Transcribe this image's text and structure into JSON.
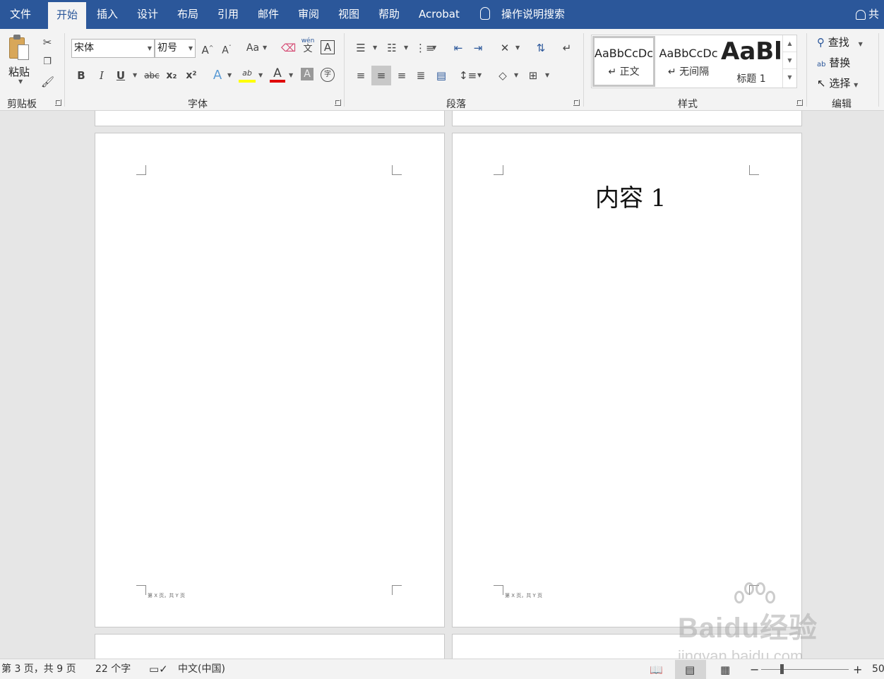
{
  "tabs": {
    "file": "文件",
    "home": "开始",
    "insert": "插入",
    "design": "设计",
    "layout": "布局",
    "references": "引用",
    "mailings": "邮件",
    "review": "审阅",
    "view": "视图",
    "help": "帮助",
    "acrobat": "Acrobat"
  },
  "tell_me": "操作说明搜索",
  "share": "共",
  "clipboard": {
    "paste": "粘贴",
    "group": "剪贴板"
  },
  "font": {
    "name": "宋体",
    "size": "初号",
    "group": "字体",
    "change_case": "Aa",
    "phonetic_top": "wén",
    "phonetic_bottom": "文",
    "bold": "B",
    "italic": "I",
    "underline": "U",
    "strike": "abc",
    "sub": "x₂",
    "sup": "x²",
    "font_color": "A",
    "highlight": "ab",
    "char_shading": "A",
    "enclose": "字"
  },
  "paragraph": {
    "group": "段落"
  },
  "styles": {
    "group": "样式",
    "items": [
      {
        "sample": "AaBbCcDc",
        "name": "↵ 正文"
      },
      {
        "sample": "AaBbCcDc",
        "name": "↵ 无间隔"
      },
      {
        "sample": "AaBl",
        "name": "标题 1"
      }
    ]
  },
  "editing": {
    "group": "编辑",
    "find": "查找",
    "replace": "替换",
    "select": "选择"
  },
  "document": {
    "page_right_heading": "内容 1",
    "footer_left": "第 X 页，共 Y 页",
    "footer_right": "第 X 页，共 Y 页"
  },
  "watermark": {
    "brand": "Baidu经验",
    "url": "jingyan.baidu.com"
  },
  "status": {
    "page": "第 3 页，共 9 页",
    "words": "22 个字",
    "language": "中文(中国)",
    "zoom": "50",
    "zoom_minus": "−",
    "zoom_plus": "+"
  },
  "colors": {
    "accent": "#2b579a",
    "highlight": "#ffff00",
    "font_color": "#e00000"
  }
}
